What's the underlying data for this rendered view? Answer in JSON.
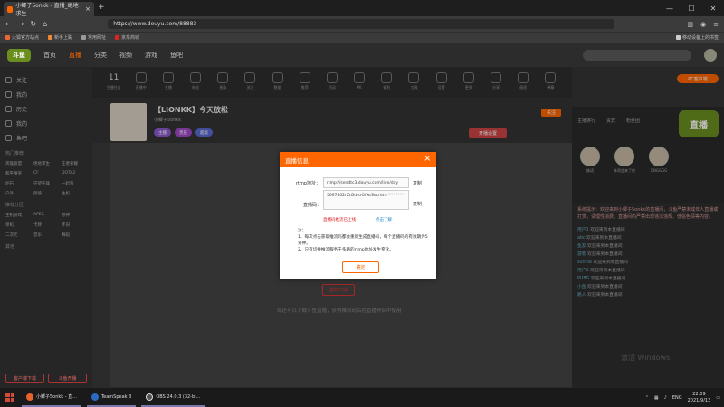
{
  "browser": {
    "tab_title": "小鲫子5onkk - 直播_绝地求生",
    "url": "https://www.douyu.com/88883",
    "bookmarks": [
      "火狐官方站点",
      "新手上路",
      "常用网址",
      "京东商城"
    ],
    "bookmark_right": "移动设备上的书签"
  },
  "site": {
    "logo": "斗鱼",
    "nav": [
      "首页",
      "直播",
      "分类",
      "视频",
      "游戏",
      "鱼吧"
    ],
    "active_nav": "直播",
    "pc_client": "PC客户端"
  },
  "sidebar": {
    "items": [
      "关注",
      "我的",
      "历史",
      "我的",
      "鱼吧"
    ],
    "section1": "热门推荐",
    "grid1": [
      "英雄联盟",
      "绝地求生",
      "王者荣耀",
      "和平精英",
      "CF",
      "DOTA2",
      "炉石",
      "守望先锋",
      "一起看",
      "户外",
      "颜值",
      "主机"
    ],
    "section2": "推荐分区",
    "grid2": [
      "主机游戏",
      "APEX",
      "原神",
      "单机",
      "卡牌",
      "怀旧",
      "二次元",
      "音乐",
      "舞蹈"
    ],
    "section3": "其他",
    "btn_left": "客户端下载",
    "btn_right": "斗鱼开播"
  },
  "categories": {
    "first_count": "11",
    "first_label": "主播任务",
    "items": [
      "直播中",
      "主播",
      "粉丝",
      "贵族",
      "关注",
      "数据",
      "推荐",
      "活动",
      "PK",
      "福利",
      "工具",
      "设置",
      "更多",
      "分享",
      "画质",
      "弹幕"
    ]
  },
  "room": {
    "title": "【LIONKK】今天放松",
    "streamer": "小鲫子5onkk",
    "badge1": "主播",
    "badge2": "贵族",
    "badge3": "超级",
    "follow": "关注",
    "live_btn": "开播设置",
    "start_hint": "重新开播",
    "hint_line": "如还可以下载斗鱼直播，获得推流码后在直播伴侣中使用"
  },
  "dialog": {
    "title": "直播信息",
    "rtmp_label": "rtmp地址：",
    "rtmp_value": "rtmp://sendtc3.douyu.com/live/day",
    "copy1": "复制",
    "code_label": "直播码：",
    "code_value": "5697402rZtGdlsrOfwtSecret=********",
    "copy2": "复制",
    "warn": "直播码推流已上线",
    "help": "点击了解",
    "notes_title": "注：",
    "notes": [
      "1、每次点击获取推流码都会重新生成直播码，每个直播码的有效期为5分钟。",
      "2、只有切换推流服务于多路的rtmp地址发生变化。"
    ],
    "ok": "确定"
  },
  "rightcol": {
    "tabs": [
      "主播排行",
      "贵宾",
      "粉丝团"
    ],
    "logo": "直播",
    "fans": [
      "佛语",
      "林哥会来了的",
      "ONGGGG"
    ],
    "notice": "系统提示：欢迎来到小鲫子5onkk的直播间，斗鱼严禁未成年人直播或打赏，请理性消费。直播间内严禁出现违法违规、低俗色情等内容。"
  },
  "chat": [
    {
      "user": "用户1",
      "text": "欢迎来到本直播间"
    },
    {
      "user": "abc",
      "text": "欢迎来到本直播间"
    },
    {
      "user": "鱼友",
      "text": "欢迎来到本直播间"
    },
    {
      "user": "游客",
      "text": "欢迎来到本直播间"
    },
    {
      "user": "sunnie",
      "text": "欢迎来到本直播间"
    },
    {
      "user": "用户2",
      "text": "欢迎来到本直播间"
    },
    {
      "user": "PUBG",
      "text": "欢迎来到本直播间"
    },
    {
      "user": "小鱼",
      "text": "欢迎来到本直播间"
    },
    {
      "user": "路人",
      "text": "欢迎来到本直播间"
    }
  ],
  "watermark": "激活 Windows",
  "taskbar": {
    "apps": [
      "小鲫子5onkk - 直...",
      "TeamSpeak 3",
      "OBS 24.0.3 (32-bi..."
    ],
    "lang": "ENG",
    "time": "22:09",
    "date": "2021/9/13"
  }
}
